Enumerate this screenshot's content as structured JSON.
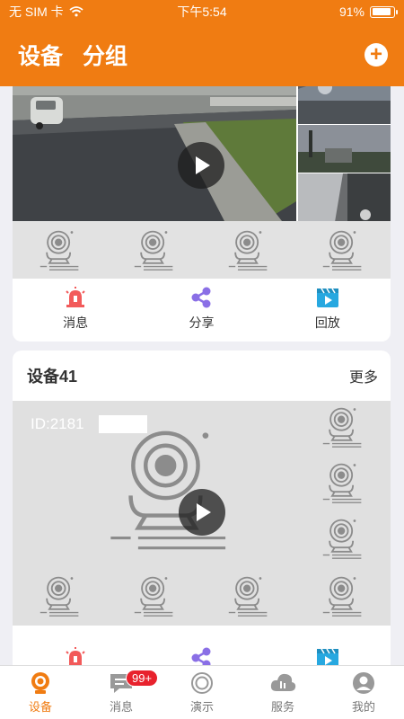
{
  "status_bar": {
    "carrier": "无 SIM 卡",
    "time": "下午5:54",
    "battery_text": "91%",
    "battery_level": 0.91
  },
  "header": {
    "tabs": [
      {
        "label": "设备"
      },
      {
        "label": "分组"
      }
    ],
    "add_button": "+"
  },
  "cards": [
    {
      "actions": [
        {
          "label": "消息",
          "icon": "alarm-icon"
        },
        {
          "label": "分享",
          "icon": "share-icon"
        },
        {
          "label": "回放",
          "icon": "playback-icon"
        }
      ]
    },
    {
      "title": "设备41",
      "more_label": "更多",
      "preview_id": "ID:2181"
    }
  ],
  "tab_bar": {
    "items": [
      {
        "label": "设备",
        "icon": "device-camera-icon",
        "active": true
      },
      {
        "label": "消息",
        "icon": "message-icon",
        "badge": "99+"
      },
      {
        "label": "演示",
        "icon": "demo-icon"
      },
      {
        "label": "服务",
        "icon": "cloud-service-icon"
      },
      {
        "label": "我的",
        "icon": "profile-icon"
      }
    ]
  },
  "colors": {
    "brand": "#f07c12",
    "alarm": "#f25a5a",
    "share": "#8a6fe6",
    "playback": "#27a8e0",
    "badge": "#e8222d"
  }
}
